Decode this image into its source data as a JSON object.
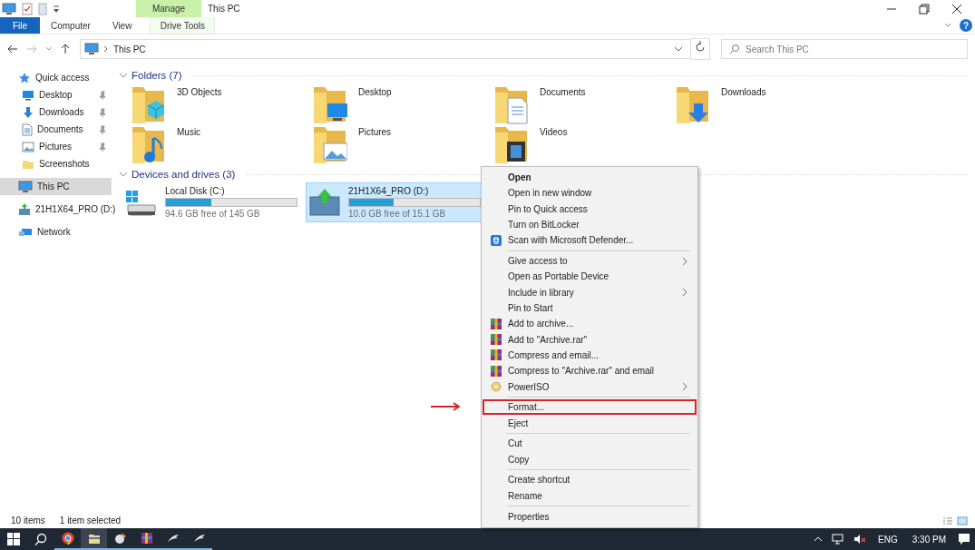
{
  "window": {
    "title": "This PC",
    "contextual_tab_group": "Manage",
    "help": "?"
  },
  "ribbon": {
    "tabs": [
      {
        "label": "File",
        "kind": "file",
        "selected": false
      },
      {
        "label": "Computer",
        "kind": "tab",
        "selected": false
      },
      {
        "label": "View",
        "kind": "tab",
        "selected": false
      },
      {
        "label": "Drive Tools",
        "kind": "contextual",
        "selected": false
      }
    ]
  },
  "address_bar": {
    "path": [
      "This PC"
    ],
    "search_placeholder": "Search This PC"
  },
  "sidebar": {
    "items": [
      {
        "label": "Quick access",
        "kind": "star",
        "selected": false,
        "children": [
          {
            "label": "Desktop",
            "kind": "desktop",
            "selected": false,
            "pinned": true
          },
          {
            "label": "Downloads",
            "kind": "download",
            "selected": false,
            "pinned": true
          },
          {
            "label": "Documents",
            "kind": "document",
            "selected": false,
            "pinned": true
          },
          {
            "label": "Pictures",
            "kind": "picture",
            "selected": false,
            "pinned": true
          },
          {
            "label": "Screenshots",
            "kind": "folder",
            "selected": false,
            "pinned": false
          }
        ]
      },
      {
        "label": "This PC",
        "kind": "pc",
        "selected": true
      },
      {
        "label": "21H1X64_PRO (D:)",
        "kind": "drive",
        "selected": false
      },
      {
        "label": "Network",
        "kind": "network",
        "selected": false
      }
    ]
  },
  "groups": [
    {
      "title": "Folders (7)",
      "kind": "folders",
      "items": [
        {
          "name": "3D Objects",
          "kind": "cube"
        },
        {
          "name": "Desktop",
          "kind": "desktop"
        },
        {
          "name": "Documents",
          "kind": "document"
        },
        {
          "name": "Downloads",
          "kind": "download"
        },
        {
          "name": "Music",
          "kind": "music"
        },
        {
          "name": "Pictures",
          "kind": "picture"
        },
        {
          "name": "Videos",
          "kind": "video"
        }
      ]
    },
    {
      "title": "Devices and drives (3)",
      "kind": "drives",
      "items": [
        {
          "name": "Local Disk (C:)",
          "kind": "system",
          "free": "94.6 GB free of 145 GB",
          "level": 0.35,
          "selected": false
        },
        {
          "name": "21H1X64_PRO (D:)",
          "kind": "setup",
          "free": "10.0 GB free of 15.1 GB",
          "level": 0.34,
          "selected": true
        }
      ]
    }
  ],
  "context_menu": {
    "items": [
      {
        "kind": "item",
        "label": "Open",
        "bold": true,
        "submenu": false
      },
      {
        "kind": "item",
        "label": "Open in new window",
        "bold": false,
        "submenu": false
      },
      {
        "kind": "item",
        "label": "Pin to Quick access",
        "bold": false,
        "submenu": false
      },
      {
        "kind": "item",
        "label": "Turn on BitLocker",
        "bold": false,
        "submenu": false
      },
      {
        "kind": "shield_item",
        "label": "Scan with Microsoft Defender...",
        "bold": false,
        "submenu": false
      },
      {
        "kind": "separator"
      },
      {
        "kind": "item",
        "label": "Give access to",
        "bold": false,
        "submenu": true
      },
      {
        "kind": "item",
        "label": "Open as Portable Device",
        "bold": false,
        "submenu": false
      },
      {
        "kind": "item",
        "label": "Include in library",
        "bold": false,
        "submenu": true
      },
      {
        "kind": "item",
        "label": "Pin to Start",
        "bold": false,
        "submenu": false
      },
      {
        "kind": "archive_item",
        "label": "Add to archive...",
        "bold": false,
        "submenu": false
      },
      {
        "kind": "archive_item",
        "label": "Add to \"Archive.rar\"",
        "bold": false,
        "submenu": false
      },
      {
        "kind": "archive_item",
        "label": "Compress and email...",
        "bold": false,
        "submenu": false
      },
      {
        "kind": "archive_item",
        "label": "Compress to \"Archive.rar\" and email",
        "bold": false,
        "submenu": false
      },
      {
        "kind": "disc_item",
        "label": "PowerISO",
        "bold": false,
        "submenu": true
      },
      {
        "kind": "separator"
      },
      {
        "kind": "item",
        "label": "Format...",
        "bold": false,
        "submenu": false,
        "annotated": true
      },
      {
        "kind": "item",
        "label": "Eject",
        "bold": false,
        "submenu": false
      },
      {
        "kind": "separator"
      },
      {
        "kind": "item",
        "label": "Cut",
        "bold": false,
        "submenu": false
      },
      {
        "kind": "item",
        "label": "Copy",
        "bold": false,
        "submenu": false
      },
      {
        "kind": "separator"
      },
      {
        "kind": "item",
        "label": "Create shortcut",
        "bold": false,
        "submenu": false
      },
      {
        "kind": "item",
        "label": "Rename",
        "bold": false,
        "submenu": false
      },
      {
        "kind": "separator"
      },
      {
        "kind": "item",
        "label": "Properties",
        "bold": false,
        "submenu": false
      }
    ]
  },
  "status_bar": {
    "item_count": "10 items",
    "selection": "1 item selected"
  },
  "taskbar": {
    "apps": [
      {
        "kind": "browser",
        "active": false
      },
      {
        "kind": "explorer",
        "active": true
      },
      {
        "kind": "tool",
        "active": false
      },
      {
        "kind": "archive",
        "active": false
      },
      {
        "kind": "bird",
        "active": false
      },
      {
        "kind": "bird",
        "active": false
      }
    ],
    "language": "ENG",
    "time": "3:30 PM"
  }
}
